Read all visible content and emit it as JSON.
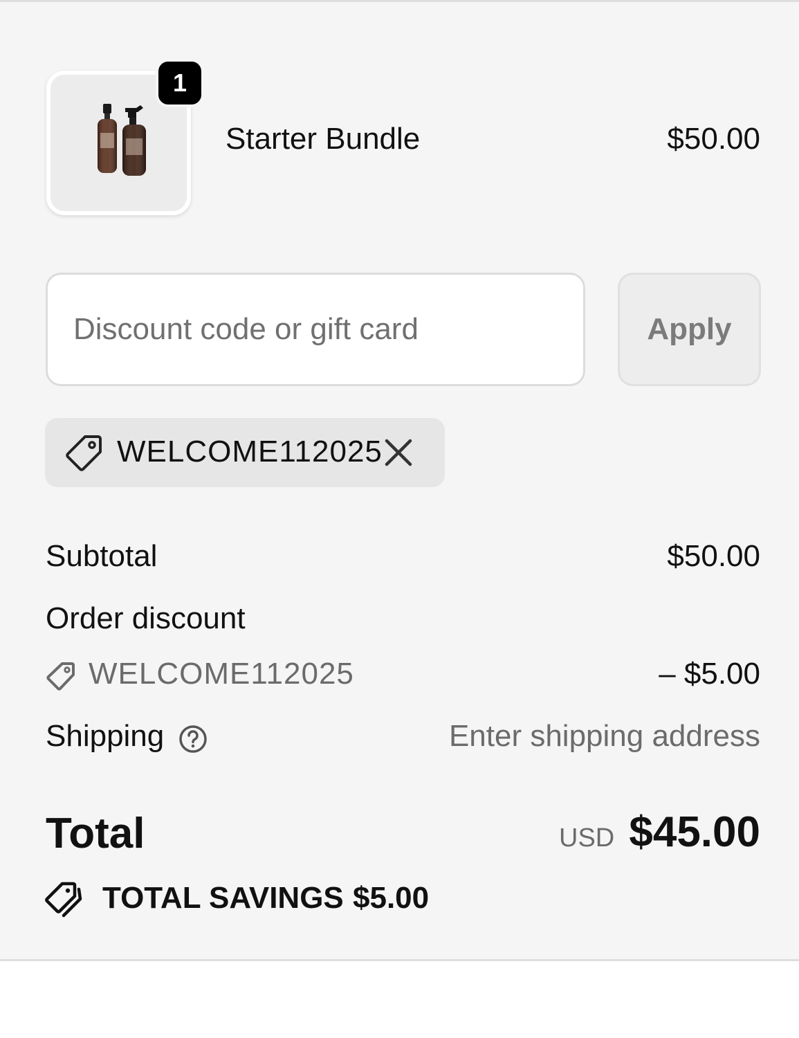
{
  "cart": {
    "item": {
      "quantity": "1",
      "name": "Starter Bundle",
      "price": "$50.00",
      "image_icon": "spray-bottles-image"
    }
  },
  "discount": {
    "placeholder": "Discount code or gift card",
    "value": "",
    "apply_label": "Apply",
    "applied_code": "WELCOME112025"
  },
  "summary": {
    "subtotal_label": "Subtotal",
    "subtotal_value": "$50.00",
    "order_discount_label": "Order discount",
    "discount_code": "WELCOME112025",
    "discount_value": "– $5.00",
    "shipping_label": "Shipping",
    "shipping_value": "Enter shipping address",
    "total_label": "Total",
    "total_currency": "USD",
    "total_value": "$45.00",
    "savings_label": "TOTAL SAVINGS",
    "savings_value": "$5.00"
  },
  "colors": {
    "panel_bg": "#f5f5f5",
    "muted_text": "#6b6b6b",
    "badge_bg": "#000000"
  }
}
